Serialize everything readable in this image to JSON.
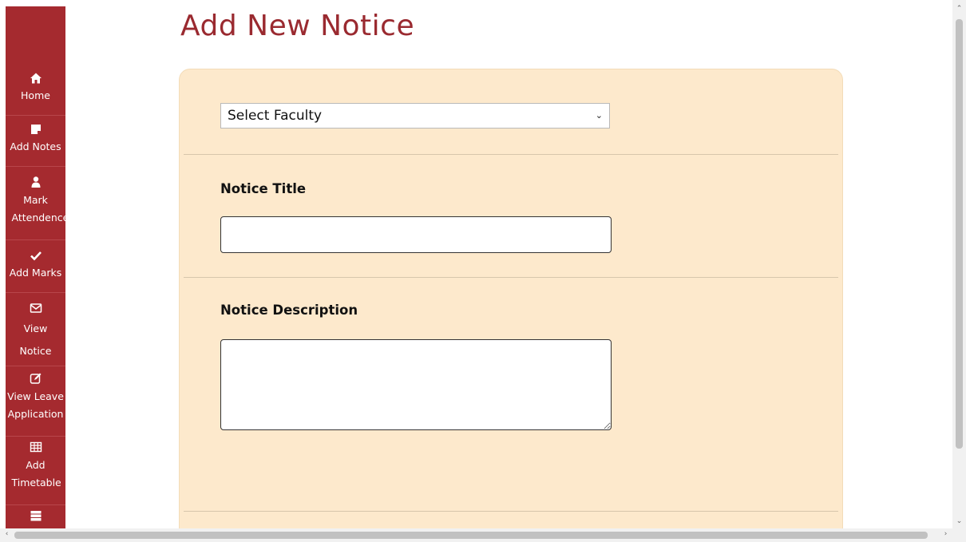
{
  "page": {
    "title": "Add New Notice"
  },
  "sidebar": {
    "items": [
      {
        "label": "Home",
        "icon": "home-icon"
      },
      {
        "label": "Add Notes",
        "icon": "note-icon"
      },
      {
        "label": "Mark Attendence",
        "icon": "user-icon"
      },
      {
        "label": "Add Marks",
        "icon": "check-icon"
      },
      {
        "label": "View Notice",
        "icon": "envelope-icon"
      },
      {
        "label": "View Leave Application",
        "icon": "edit-icon"
      },
      {
        "label": "Add Timetable",
        "icon": "table-icon"
      },
      {
        "label": "",
        "icon": "server-icon"
      }
    ]
  },
  "form": {
    "faculty_select": {
      "selected": "Select Faculty"
    },
    "notice_title": {
      "label": "Notice Title",
      "value": ""
    },
    "notice_description": {
      "label": "Notice Description",
      "value": ""
    }
  },
  "colors": {
    "sidebar_bg": "#a52a2f",
    "title": "#9a2a30",
    "card_bg": "#fde9cc"
  }
}
